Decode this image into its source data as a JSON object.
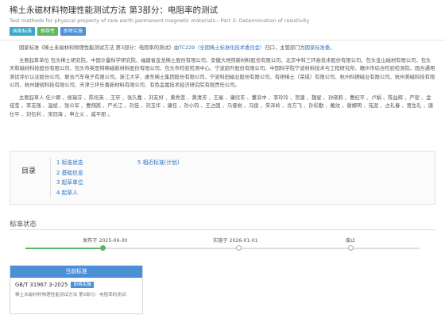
{
  "header": {
    "title": "稀土永磁材料物理性能测试方法 第3部分：电阻率的测试",
    "subtitle": "Test methods for physical property of rare earth permanent magnetic materials—Part 3: Determination of resistivity",
    "badges": [
      "国家标准",
      "推荐性",
      "即将实施"
    ]
  },
  "intro": {
    "p1_pre": "国家标准《稀土永磁材料物理性能测试方法 第3部分：电阻率的测试》由",
    "p1_link1": "TC229（全国稀土标准化技术委员会）",
    "p1_mid": "归口，主管部门为",
    "p1_link2": "国家标准委",
    "p1_end": "。",
    "p2": "主要起草单位 包头稀土研究院、中国计量科学研究院、福建省金龙稀土股份有限公司、安徽大地熊新材料股份有限公司、北京中科三环高技术股份有限公司、包头金山磁材有限公司、包头天和磁材科技股份有限公司、包头市英思特稀磁新材料股份有限公司、包头市检验检测中心、宁波韵升股份有限公司、中国科学院宁波材料技术与工程研究所、赣州市综合检验检测院、国合通用测试评价认证股份公司、联合汽车电子有限公司、浙江大学、虔东稀土集团股份有限公司、宁波科田磁业股份有限公司、有研稀土（荣成）有限公司、杭州科德磁业有限公司、杭州美磁科技有限公司、杭州捷锐科技有限公司、天津三环乐喜新材料有限公司、有色金属技术经济研究院有限责任公司。",
    "p3": "主要起草人 任少卿 、侯瑞芬 、陈培英 、王轩 、张久嘉 、刘友好 、黄秀莲 、黄清芳 、王瑜 、康欣东 、董欢中 、李玲玲 、贺建 、魏星 、孙晓莉 、曹纪平 、卢娟 、陈益辉 、严密 、金佳莹 、李志强 、温斌 、张公军 、曹翔嵩 、严长江 、刘佳 、刘玉华 、康任 、孙小钧 、王占国 、马睿岩 、冯俊 、朱泽岭 、肖方飞 、孙彩勤 、戴纹 、谢娜明 、苑涯 、占礼春 、贾生礼 、唐仕平 、刘伍利 、宋冠海 、申立义 、戚平朋 。"
  },
  "toc": {
    "title": "目录",
    "items_col1": [
      "1 标准状态",
      "2 基础信息",
      "3 起草单位",
      "4 起草人"
    ],
    "items_col2": [
      "5 相近标准(计划)"
    ]
  },
  "status_section": {
    "title": "标准状态",
    "timeline": [
      {
        "label": "发布于 2025-06-30",
        "active": true
      },
      {
        "label": "实施于 2026-01-01",
        "active": false
      },
      {
        "label": "废止",
        "active": false
      }
    ],
    "card": {
      "header": "当前标准",
      "code": "GB/T 31967.3-2025",
      "status_badge": "即将实施",
      "desc": "稀土永磁材料物理性能测试方法 第3部分：电阻率的测试"
    }
  },
  "colors": {
    "accent_blue": "#4c8fd6",
    "accent_green": "#59b36a",
    "link": "#2a70c0"
  }
}
